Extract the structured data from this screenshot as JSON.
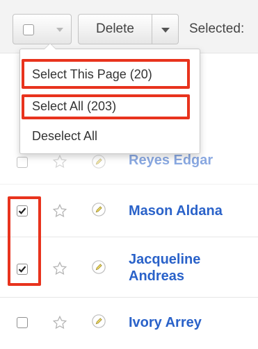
{
  "toolbar": {
    "delete_label": "Delete",
    "selected_label": "Selected:"
  },
  "dropdown": {
    "items": [
      {
        "label": "Select This Page (20)"
      },
      {
        "label": "Select All (203)"
      },
      {
        "label": "Deselect All"
      }
    ]
  },
  "rows": [
    {
      "name": "Reyes Edgar",
      "checked": false,
      "favorite": false
    },
    {
      "name": "Mason Aldana",
      "checked": true,
      "favorite": false
    },
    {
      "name_line1": "Jacqueline",
      "name_line2": "Andreas",
      "checked": true,
      "favorite": false
    },
    {
      "name": "Ivory Arrey",
      "checked": false,
      "favorite": false
    }
  ],
  "colors": {
    "link": "#2a62c9",
    "highlight": "#e8331d",
    "toolbar_bg": "#f3f3f3"
  },
  "icons": {
    "checkbox": "checkbox-icon",
    "star": "star-icon",
    "edit": "pencil-icon",
    "caret": "chevron-down-icon"
  }
}
